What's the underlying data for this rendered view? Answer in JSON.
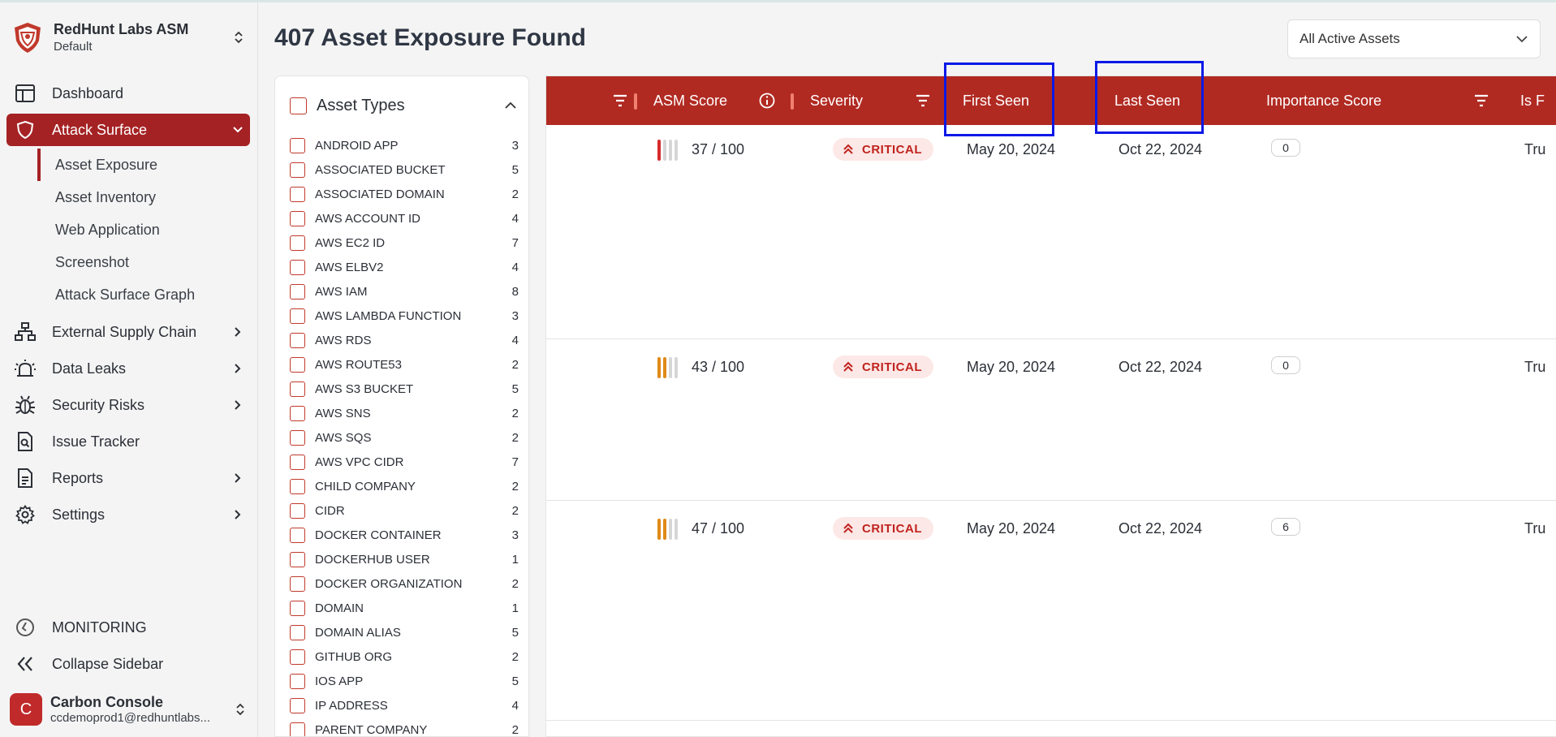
{
  "app": {
    "org_name": "RedHunt Labs ASM",
    "org_sub": "Default"
  },
  "nav": {
    "dashboard": "Dashboard",
    "attack_surface": "Attack Surface",
    "sub": [
      "Asset Exposure",
      "Asset Inventory",
      "Web Application",
      "Screenshot",
      "Attack Surface Graph"
    ],
    "external_supply_chain": "External Supply Chain",
    "data_leaks": "Data Leaks",
    "security_risks": "Security Risks",
    "issue_tracker": "Issue Tracker",
    "reports": "Reports",
    "settings": "Settings",
    "monitoring": "MONITORING",
    "collapse": "Collapse Sidebar"
  },
  "user": {
    "initial": "C",
    "name": "Carbon Console",
    "email": "ccdemoprod1@redhuntlabs..."
  },
  "header": {
    "title": "407 Asset Exposure Found",
    "asset_filter": "All Active Assets"
  },
  "filter": {
    "title": "Asset Types",
    "items": [
      {
        "label": "ANDROID APP",
        "count": "3"
      },
      {
        "label": "ASSOCIATED BUCKET",
        "count": "5"
      },
      {
        "label": "ASSOCIATED DOMAIN",
        "count": "2"
      },
      {
        "label": "AWS ACCOUNT ID",
        "count": "4"
      },
      {
        "label": "AWS EC2 ID",
        "count": "7"
      },
      {
        "label": "AWS ELBV2",
        "count": "4"
      },
      {
        "label": "AWS IAM",
        "count": "8"
      },
      {
        "label": "AWS LAMBDA FUNCTION",
        "count": "3"
      },
      {
        "label": "AWS RDS",
        "count": "4"
      },
      {
        "label": "AWS ROUTE53",
        "count": "2"
      },
      {
        "label": "AWS S3 BUCKET",
        "count": "5"
      },
      {
        "label": "AWS SNS",
        "count": "2"
      },
      {
        "label": "AWS SQS",
        "count": "2"
      },
      {
        "label": "AWS VPC CIDR",
        "count": "7"
      },
      {
        "label": "CHILD COMPANY",
        "count": "2"
      },
      {
        "label": "CIDR",
        "count": "2"
      },
      {
        "label": "DOCKER CONTAINER",
        "count": "3"
      },
      {
        "label": "DOCKERHUB USER",
        "count": "1"
      },
      {
        "label": "DOCKER ORGANIZATION",
        "count": "2"
      },
      {
        "label": "DOMAIN",
        "count": "1"
      },
      {
        "label": "DOMAIN ALIAS",
        "count": "5"
      },
      {
        "label": "GITHUB ORG",
        "count": "2"
      },
      {
        "label": "IOS APP",
        "count": "5"
      },
      {
        "label": "IP ADDRESS",
        "count": "4"
      },
      {
        "label": "PARENT COMPANY",
        "count": "2"
      }
    ]
  },
  "table": {
    "columns": {
      "asm_score": "ASM Score",
      "severity": "Severity",
      "first_seen": "First Seen",
      "last_seen": "Last Seen",
      "importance": "Importance Score",
      "is": "Is F"
    },
    "rows": [
      {
        "score": "37 / 100",
        "score_level": 1,
        "score_color": "#d62b2b",
        "severity": "CRITICAL",
        "first_seen": "May 20, 2024",
        "last_seen": "Oct 22, 2024",
        "importance": "0",
        "is": "Tru"
      },
      {
        "score": "43 / 100",
        "score_level": 2,
        "score_color": "#e08a17",
        "severity": "CRITICAL",
        "first_seen": "May 20, 2024",
        "last_seen": "Oct 22, 2024",
        "importance": "0",
        "is": "Tru"
      },
      {
        "score": "47 / 100",
        "score_level": 2,
        "score_color": "#e08a17",
        "severity": "CRITICAL",
        "first_seen": "May 20, 2024",
        "last_seen": "Oct 22, 2024",
        "importance": "6",
        "is": "Tru"
      }
    ]
  },
  "colors": {
    "brand": "#a52224",
    "header": "#b12a22",
    "highlight": "#0b19e6"
  }
}
